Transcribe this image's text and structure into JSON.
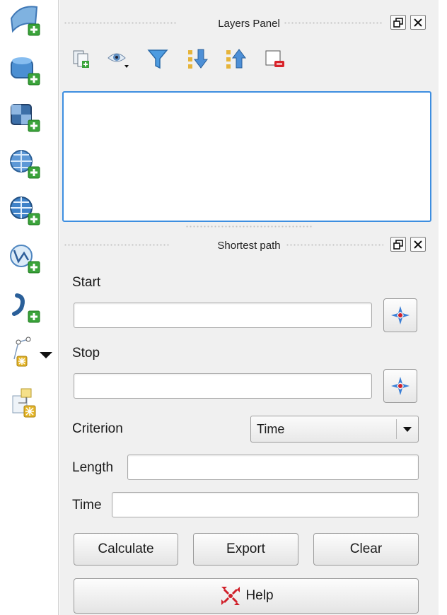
{
  "left_toolbar": {
    "icons": [
      "add-vector-layer-icon",
      "add-postgis-layer-icon",
      "add-raster-layer-icon",
      "add-wms-layer-icon",
      "add-wfs-layer-icon",
      "add-delimited-text-layer-icon",
      "add-gpx-layer-icon",
      "new-shapefile-layer-icon",
      "new-spatialite-layer-icon"
    ]
  },
  "layers_panel": {
    "title": "Layers Panel",
    "toolbar": [
      "add-group-icon",
      "manage-visibility-icon",
      "filter-legend-icon",
      "expand-all-icon",
      "collapse-all-icon",
      "remove-layer-icon"
    ]
  },
  "shortest_path": {
    "title": "Shortest path",
    "start_label": "Start",
    "start_value": "",
    "stop_label": "Stop",
    "stop_value": "",
    "criterion_label": "Criterion",
    "criterion_value": "Time",
    "length_label": "Length",
    "length_value": "",
    "time_label": "Time",
    "time_value": "",
    "calculate_label": "Calculate",
    "export_label": "Export",
    "clear_label": "Clear",
    "help_label": "Help"
  },
  "colors": {
    "accent_focus": "#3d8ee0",
    "panel_bg": "#f0f0f0",
    "capture_point": "#3a7fd6",
    "capture_center": "#d0202a"
  }
}
